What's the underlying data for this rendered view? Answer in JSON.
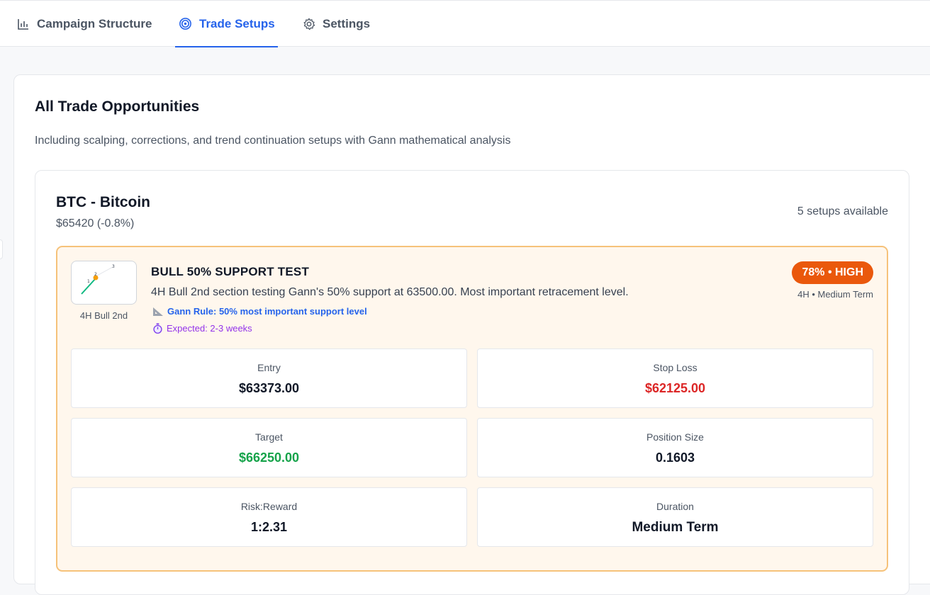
{
  "tabs": [
    {
      "label": "Campaign Structure",
      "icon": "bar-chart-icon",
      "active": false
    },
    {
      "label": "Trade Setups",
      "icon": "target-icon",
      "active": true
    },
    {
      "label": "Settings",
      "icon": "gear-icon",
      "active": false
    }
  ],
  "page": {
    "title": "All Trade Opportunities",
    "subtitle": "Including scalping, corrections, and trend continuation setups with Gann mathematical analysis"
  },
  "asset": {
    "name": "BTC - Bitcoin",
    "price": "$65420 (-0.8%)",
    "setups_count": "5 setups available"
  },
  "setup": {
    "thumb_label": "4H Bull 2nd",
    "title": "BULL 50% SUPPORT TEST",
    "description": "4H Bull 2nd section testing Gann's 50% support at 63500.00. Most important retracement level.",
    "gann_rule": "Gann Rule: 50% most important support level",
    "expected": "Expected: 2-3 weeks",
    "confidence": "78% • HIGH",
    "timeframe": "4H • Medium Term",
    "metrics": {
      "entry_label": "Entry",
      "entry_value": "$63373.00",
      "stop_label": "Stop Loss",
      "stop_value": "$62125.00",
      "target_label": "Target",
      "target_value": "$66250.00",
      "size_label": "Position Size",
      "size_value": "0.1603",
      "rr_label": "Risk:Reward",
      "rr_value": "1:2.31",
      "duration_label": "Duration",
      "duration_value": "Medium Term"
    }
  },
  "colors": {
    "accent": "#2563eb",
    "badge": "#ea580c",
    "stop": "#dc2626",
    "target": "#16a34a",
    "card_bg": "#fff7ed",
    "card_border": "#f6c27a"
  }
}
